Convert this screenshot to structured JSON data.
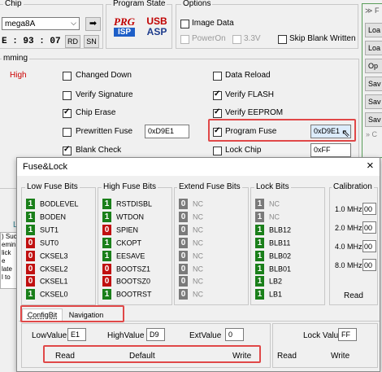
{
  "main": {
    "chip_group": "Chip",
    "chip_select": "mega8A",
    "chip_id": "E : 93 : 07",
    "rd": "RD",
    "sn": "SN",
    "program_state_group": "Program State",
    "prg_line1": "PRG",
    "prg_line2": "ISP",
    "usb_line1": "USB",
    "usb_line2": "ASP",
    "options_group": "Options",
    "image_data": "Image Data",
    "power_on": "PowerOn",
    "v33": "3.3V",
    "skip_blank": "Skip Blank Written",
    "programming_group": "mming",
    "speed": "High",
    "changed_down": "Changed Down",
    "verify_signature": "Verify Signature",
    "chip_erase": "Chip Erase",
    "prewritten_fuse": "Prewritten Fuse",
    "prewritten_value": "0xD9E1",
    "blank_check": "Blank Check",
    "data_reload": "Data Reload",
    "verify_flash": "Verify FLASH",
    "verify_eeprom": "Verify EEPROM",
    "program_fuse": "Program Fuse",
    "program_fuse_value": "0xD9E1",
    "lock_chip": "Lock Chip",
    "lock_value": "0xFF",
    "side_header": "F",
    "side_buttons": [
      "Loa",
      "Loa",
      "Op",
      "Sav",
      "Sav",
      "Sav"
    ],
    "side_footer": "C",
    "left_lo": "Lo",
    "left_text": [
      ") Suc",
      "emin",
      "lick",
      "e late",
      "l to"
    ]
  },
  "dialog": {
    "title": "Fuse&Lock",
    "close": "×",
    "low_header": "Low Fuse Bits",
    "high_header": "High Fuse Bits",
    "extend_header": "Extend Fuse Bits",
    "lock_header": "Lock Bits",
    "calibration_header": "Calibration",
    "low_bits": [
      {
        "v": "1",
        "name": "BODLEVEL"
      },
      {
        "v": "1",
        "name": "BODEN"
      },
      {
        "v": "1",
        "name": "SUT1"
      },
      {
        "v": "0",
        "name": "SUT0"
      },
      {
        "v": "0",
        "name": "CKSEL3"
      },
      {
        "v": "0",
        "name": "CKSEL2"
      },
      {
        "v": "0",
        "name": "CKSEL1"
      },
      {
        "v": "1",
        "name": "CKSEL0"
      }
    ],
    "high_bits": [
      {
        "v": "1",
        "name": "RSTDISBL"
      },
      {
        "v": "1",
        "name": "WTDON"
      },
      {
        "v": "0",
        "name": "SPIEN"
      },
      {
        "v": "1",
        "name": "CKOPT"
      },
      {
        "v": "1",
        "name": "EESAVE"
      },
      {
        "v": "0",
        "name": "BOOTSZ1"
      },
      {
        "v": "0",
        "name": "BOOTSZ0"
      },
      {
        "v": "1",
        "name": "BOOTRST"
      }
    ],
    "extend_bits": [
      {
        "v": "0",
        "name": "NC"
      },
      {
        "v": "0",
        "name": "NC"
      },
      {
        "v": "0",
        "name": "NC"
      },
      {
        "v": "0",
        "name": "NC"
      },
      {
        "v": "0",
        "name": "NC"
      },
      {
        "v": "0",
        "name": "NC"
      },
      {
        "v": "0",
        "name": "NC"
      },
      {
        "v": "0",
        "name": "NC"
      }
    ],
    "lock_bits": [
      {
        "v": "1",
        "name": "NC",
        "nc": true
      },
      {
        "v": "1",
        "name": "NC",
        "nc": true
      },
      {
        "v": "1",
        "name": "BLB12"
      },
      {
        "v": "1",
        "name": "BLB11"
      },
      {
        "v": "1",
        "name": "BLB02"
      },
      {
        "v": "1",
        "name": "BLB01"
      },
      {
        "v": "1",
        "name": "LB2"
      },
      {
        "v": "1",
        "name": "LB1"
      }
    ],
    "calibration": [
      {
        "label": "1.0 MHz",
        "value": "00"
      },
      {
        "label": "2.0 MHz",
        "value": "00"
      },
      {
        "label": "4.0 MHz",
        "value": "00"
      },
      {
        "label": "8.0 MHz",
        "value": "00"
      }
    ],
    "calibration_read": "Read",
    "tab_configbit": "ConfigBit",
    "tab_navigation": "Navigation",
    "low_value_label": "LowValue",
    "low_value": "E1",
    "high_value_label": "HighValue",
    "high_value": "D9",
    "ext_value_label": "ExtValue",
    "ext_value": "0",
    "lock_value_label": "Lock Value",
    "lock_value": "FF",
    "read": "Read",
    "default": "Default",
    "write": "Write",
    "lock_read": "Read",
    "lock_write": "Write"
  },
  "colors": {
    "bit_one": "#1a7f1a",
    "bit_zero": "#c01010",
    "bit_nc": "#7a7a7a",
    "highlight": "#e04848",
    "speed": "#cc0000"
  }
}
